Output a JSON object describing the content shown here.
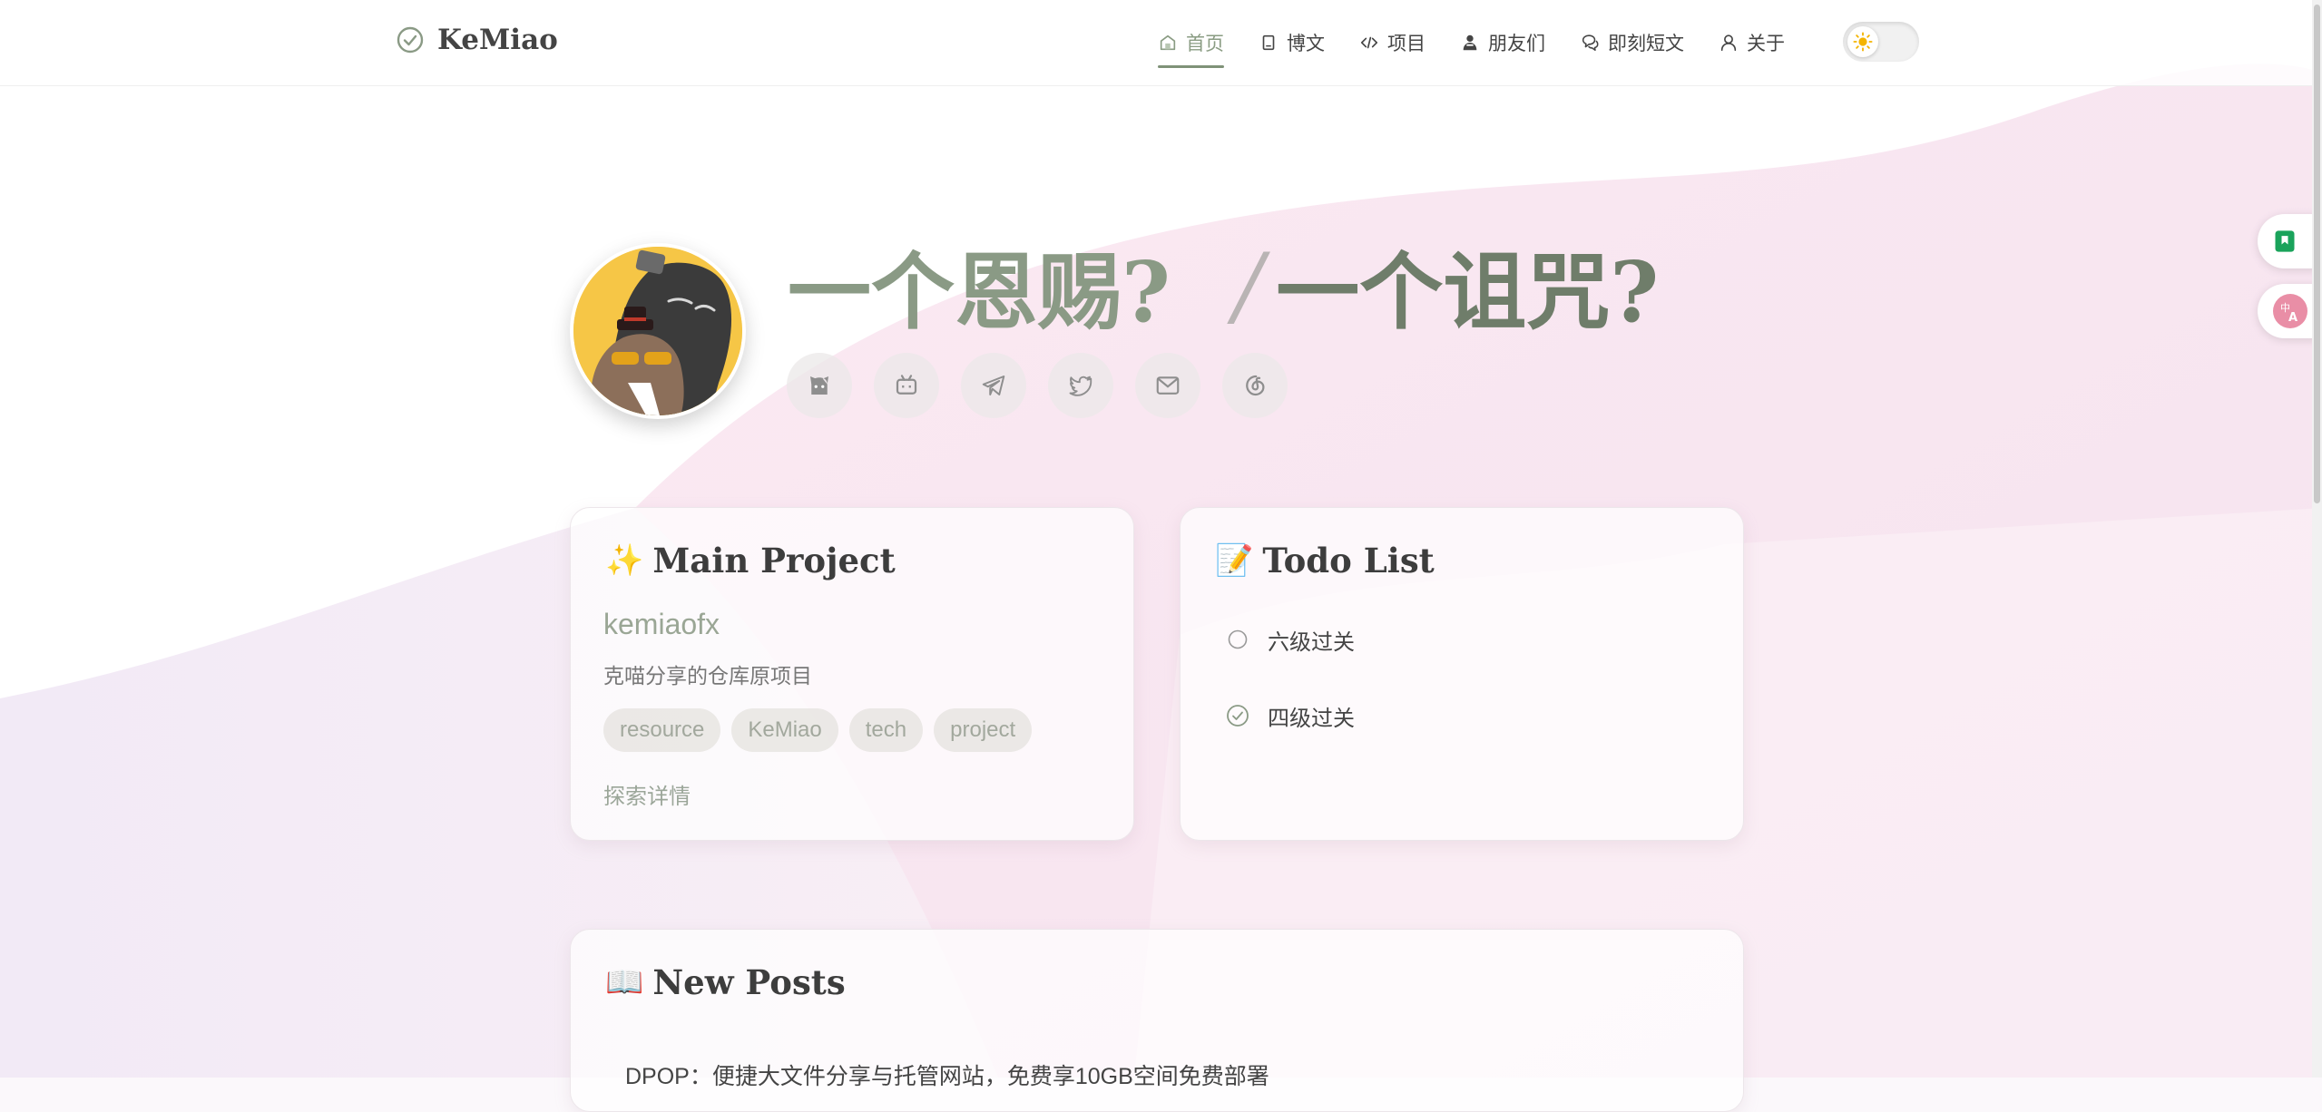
{
  "brand": {
    "name": "KeMiao",
    "logo_icon": "check-circle-icon"
  },
  "nav": {
    "items": [
      {
        "label": "首页",
        "icon": "home-icon",
        "active": true
      },
      {
        "label": "博文",
        "icon": "document-icon",
        "active": false
      },
      {
        "label": "项目",
        "icon": "code-icon",
        "active": false
      },
      {
        "label": "朋友们",
        "icon": "friends-icon",
        "active": false
      },
      {
        "label": "即刻短文",
        "icon": "chat-icon",
        "active": false
      },
      {
        "label": "关于",
        "icon": "user-icon",
        "active": false
      }
    ],
    "theme_toggle": {
      "icon": "sun-icon",
      "state": "light"
    }
  },
  "hero": {
    "title_part1": "一个恩赐?",
    "separator": "/",
    "title_part2": "一个诅咒?",
    "socials": [
      "github-icon",
      "bilibili-icon",
      "telegram-icon",
      "twitter-icon",
      "mail-icon",
      "netease-music-icon"
    ]
  },
  "main_project": {
    "emoji": "✨",
    "title": "Main Project",
    "name": "kemiaofx",
    "description": "克喵分享的仓库原项目",
    "tags": [
      "resource",
      "KeMiao",
      "tech",
      "project"
    ],
    "explore_label": "探索详情"
  },
  "todo": {
    "emoji": "📝",
    "title": "Todo List",
    "items": [
      {
        "label": "六级过关",
        "done": false
      },
      {
        "label": "四级过关",
        "done": true
      }
    ]
  },
  "posts": {
    "emoji": "📖",
    "title": "New Posts",
    "first_post": "DPOP：便捷大文件分享与托管网站，免费享10GB空间免费部署"
  },
  "colors": {
    "accent": "#7f9278",
    "title_light": "#8a9a85",
    "title_dark": "#6f7d6a"
  }
}
